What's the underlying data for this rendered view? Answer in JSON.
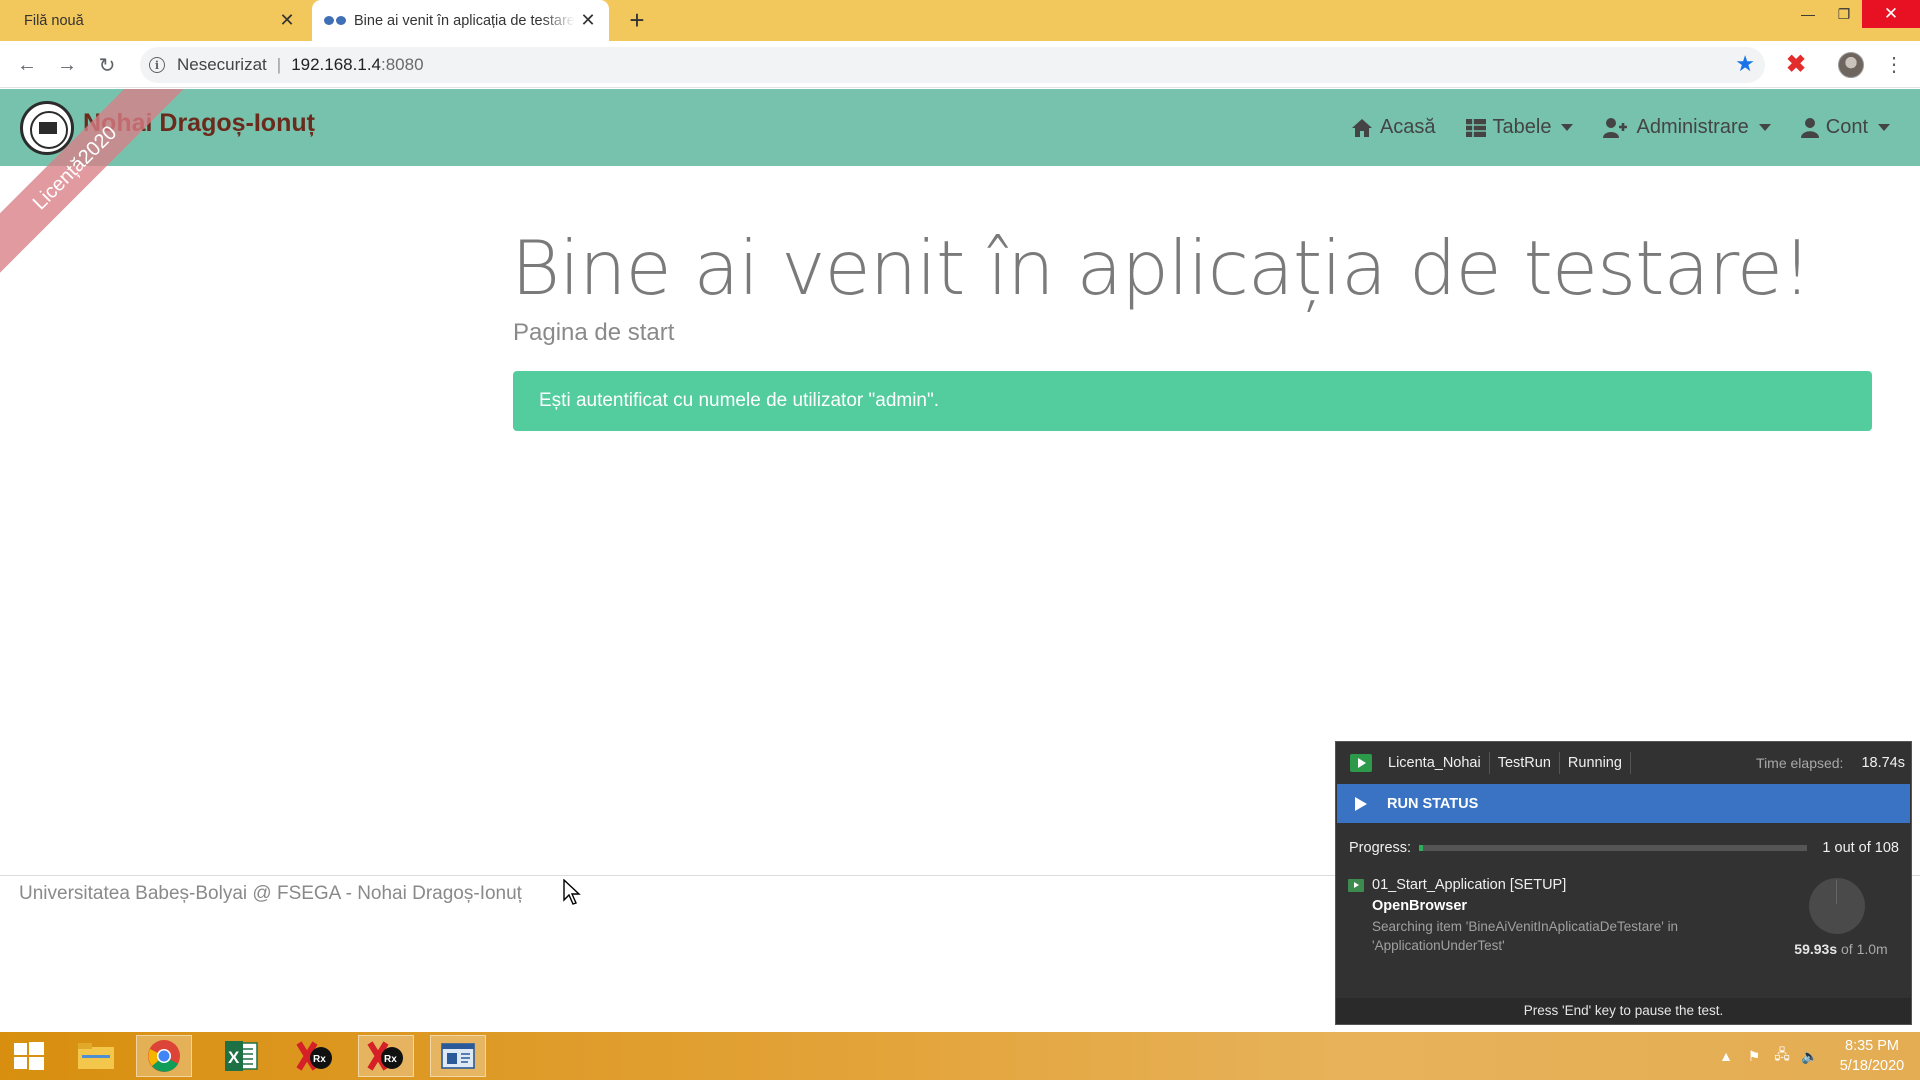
{
  "browser": {
    "tabs": [
      {
        "title": "Filă nouă",
        "active": false
      },
      {
        "title": "Bine ai venit în aplicația de testare",
        "active": true
      }
    ],
    "new_tab_label": "+",
    "security_label": "Nesecurizat",
    "url_host": "192.168.1.4",
    "url_port": ":8080",
    "omnibox_separator": "|"
  },
  "navbar": {
    "brand": "Nohai Dragoș-Ionuț",
    "items": [
      {
        "label": "Acasă",
        "icon": "home-icon",
        "dropdown": false
      },
      {
        "label": "Tabele",
        "icon": "table-icon",
        "dropdown": true
      },
      {
        "label": "Administrare",
        "icon": "user-plus-icon",
        "dropdown": true
      },
      {
        "label": "Cont",
        "icon": "user-icon",
        "dropdown": true
      }
    ]
  },
  "ribbon": {
    "text": "Licență2020"
  },
  "main": {
    "title": "Bine ai venit în aplicația de testare!",
    "subtitle": "Pagina de start",
    "alert": "Ești autentificat cu numele de utilizator \"admin\"."
  },
  "footer": {
    "text": "Universitatea Babeș-Bolyai @ FSEGA - Nohai Dragoș-Ionuț"
  },
  "runner": {
    "project": "Licenta_Nohai",
    "test": "TestRun",
    "state": "Running",
    "elapsed_label": "Time elapsed:",
    "elapsed_value": "18.74s",
    "status_title": "RUN STATUS",
    "progress_label": "Progress:",
    "progress_count": "1 out of 108",
    "progress_fraction": 0.0093,
    "item_name": "01_Start_Application [SETUP]",
    "item_action": "OpenBrowser",
    "item_desc": "Searching item 'BineAiVenitInAplicatiaDeTestare' in 'ApplicationUnderTest'",
    "timer_value": "59.93s",
    "timer_suffix": " of 1.0m",
    "footer_hint": "Press 'End' key to pause the test."
  },
  "taskbar": {
    "apps": [
      "file-explorer-icon",
      "chrome-icon",
      "excel-icon",
      "ranorex-icon",
      "ranorex-icon",
      "window-icon"
    ],
    "time": "8:35 PM",
    "date": "5/18/2020"
  },
  "colors": {
    "tabstrip": "#f2c75c",
    "navbar": "#76c2ad",
    "brand": "#6b2a1c",
    "alert": "#53cc9e",
    "ribbon": "#da7e86",
    "runner_bg": "#323232",
    "run_status": "#3a73c3"
  }
}
